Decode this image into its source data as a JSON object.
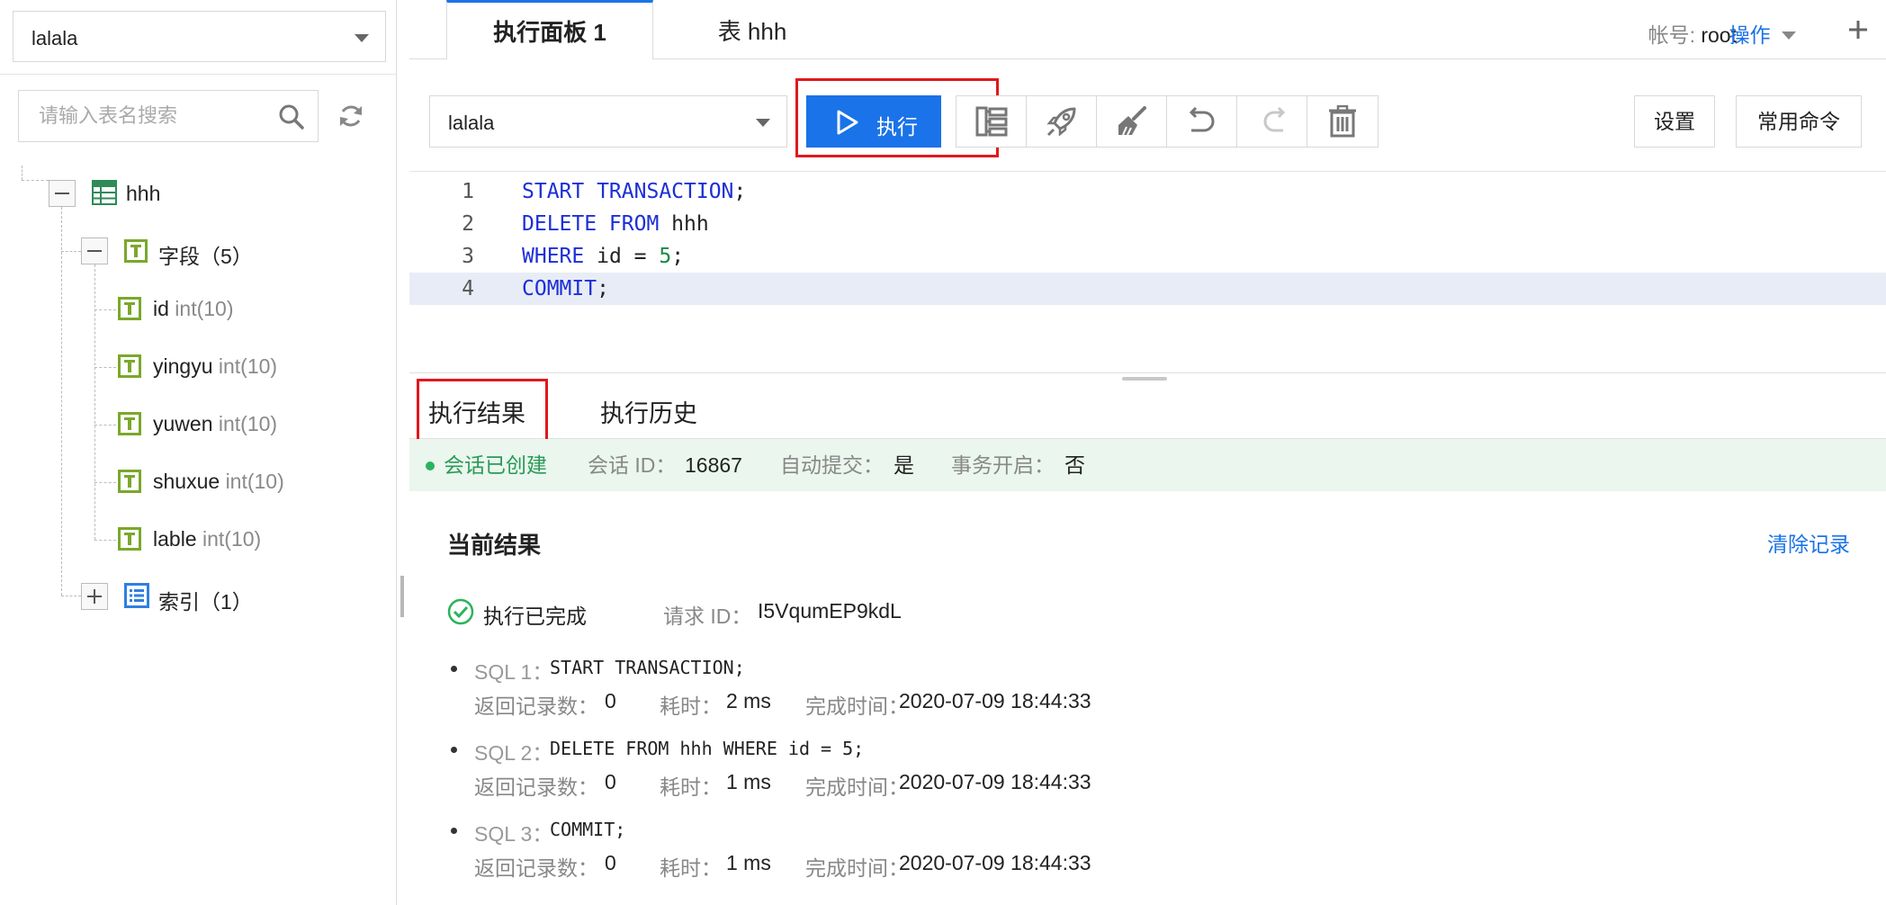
{
  "sidebar": {
    "db_select": "lalala",
    "search_placeholder": "请输入表名搜索",
    "tree": {
      "table_name": "hhh",
      "fields_label": "字段（5）",
      "fields": [
        {
          "name": "id",
          "type": "int(10)"
        },
        {
          "name": "yingyu",
          "type": "int(10)"
        },
        {
          "name": "yuwen",
          "type": "int(10)"
        },
        {
          "name": "shuxue",
          "type": "int(10)"
        },
        {
          "name": "lable",
          "type": "int(10)"
        }
      ],
      "index_label": "索引（1）"
    }
  },
  "tabs": [
    {
      "label": "执行面板 1",
      "active": true
    },
    {
      "label": "表 hhh",
      "active": false
    }
  ],
  "header": {
    "account_label": "帐号:",
    "account_user": "root",
    "ops_label": "操作"
  },
  "toolbar": {
    "conn_select": "lalala",
    "run_label": "执行",
    "tool_icons": [
      "tree-structure-icon",
      "rocket-icon",
      "broom-icon",
      "undo-icon",
      "redo-icon",
      "trash-icon"
    ],
    "settings_label": "设置",
    "common_cmd_label": "常用命令"
  },
  "editor": {
    "line_numbers": [
      "1",
      "2",
      "3",
      "4"
    ],
    "lines": [
      [
        {
          "t": "START TRANSACTION",
          "k": "kw"
        },
        {
          "t": ";",
          "k": ""
        }
      ],
      [
        {
          "t": "DELETE FROM",
          "k": "kw"
        },
        {
          "t": " hhh",
          "k": ""
        }
      ],
      [
        {
          "t": "WHERE",
          "k": "kw"
        },
        {
          "t": " id = ",
          "k": ""
        },
        {
          "t": "5",
          "k": "num"
        },
        {
          "t": ";",
          "k": ""
        }
      ],
      [
        {
          "t": "COMMIT",
          "k": "kw"
        },
        {
          "t": ";",
          "k": ""
        }
      ]
    ],
    "current_line": 4
  },
  "result_tabs": [
    "执行结果",
    "执行历史"
  ],
  "session": {
    "status": "会话已创建",
    "session_id_label": "会话 ID：",
    "session_id": "16867",
    "autocommit_label": "自动提交：",
    "autocommit": "是",
    "txn_label": "事务开启：",
    "txn": "否"
  },
  "results": {
    "title": "当前结果",
    "clear_label": "清除记录",
    "done_text": "执行已完成",
    "request_id_label": "请求 ID：",
    "request_id": "I5VqumEP9kdL",
    "rows_label": "返回记录数：",
    "time_label": "耗时：",
    "finish_label": "完成时间：",
    "sql": [
      {
        "tag": "SQL 1：",
        "stmt": "START TRANSACTION;",
        "rows": "0",
        "time": "2 ms",
        "finish": "2020-07-09 18:44:33"
      },
      {
        "tag": "SQL 2：",
        "stmt": "DELETE FROM hhh WHERE id = 5;",
        "rows": "0",
        "time": "1 ms",
        "finish": "2020-07-09 18:44:33"
      },
      {
        "tag": "SQL 3：",
        "stmt": "COMMIT;",
        "rows": "0",
        "time": "1 ms",
        "finish": "2020-07-09 18:44:33"
      }
    ]
  },
  "colors": {
    "accent": "#1a73e8",
    "highlight_box": "#e0181d",
    "field_icon": "#7aa82b",
    "session_bg": "#eaf6ee"
  }
}
